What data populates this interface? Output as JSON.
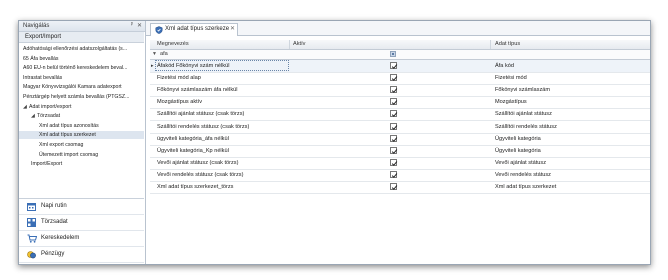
{
  "nav": {
    "title": "Navigálás",
    "pin": "ᵖ",
    "close": "✕",
    "section": "Export/Import",
    "tree": [
      {
        "label": "Adóhatósági ellenőrzési adatszolgáltatás (s...",
        "indent": 0,
        "arrow": "",
        "selected": false
      },
      {
        "label": "65 Áfa bevallás",
        "indent": 0,
        "arrow": "",
        "selected": false
      },
      {
        "label": "A60 EU-n belül történő kereskedelem beval...",
        "indent": 0,
        "arrow": "",
        "selected": false
      },
      {
        "label": "Intrastat bevallás",
        "indent": 0,
        "arrow": "",
        "selected": false
      },
      {
        "label": "Magyar Könyvvizsgálói Kamara adatexport",
        "indent": 0,
        "arrow": "",
        "selected": false
      },
      {
        "label": "Pénztárgép helyett számla bevallás (PTGSZ...",
        "indent": 0,
        "arrow": "",
        "selected": false
      },
      {
        "label": "Adat import/export",
        "indent": 0,
        "arrow": "◢",
        "selected": false
      },
      {
        "label": "Törzsadat",
        "indent": 1,
        "arrow": "◢",
        "selected": false
      },
      {
        "label": "Xml adat típus azonosítás",
        "indent": 2,
        "arrow": "",
        "selected": false
      },
      {
        "label": "Xml adat típus szerkezet",
        "indent": 2,
        "arrow": "",
        "selected": true
      },
      {
        "label": "Xml export csomag",
        "indent": 2,
        "arrow": "",
        "selected": false
      },
      {
        "label": "Ütemezett import csomag",
        "indent": 2,
        "arrow": "",
        "selected": false
      },
      {
        "label": "Import/Export",
        "indent": 1,
        "arrow": "",
        "selected": false
      }
    ],
    "modules": [
      {
        "label": "Napi rutin",
        "icon": "calendar-icon"
      },
      {
        "label": "Törzsadat",
        "icon": "grid-icon"
      },
      {
        "label": "Kereskedelem",
        "icon": "cart-icon"
      },
      {
        "label": "Pénzügy",
        "icon": "coins-icon"
      }
    ]
  },
  "tab": {
    "label": "Xml adat típus szerkeze",
    "close": "✕"
  },
  "grid": {
    "headers": [
      "Megnevezés",
      "Aktív",
      "Adat típus"
    ],
    "filter_indicator": "▼",
    "filter_value": "afa",
    "row_indicator": "▸",
    "rows": [
      {
        "name": "Áfakód Főkönyvi szám nélkül",
        "active": true,
        "type": "Áfa kód"
      },
      {
        "name": "Fizetési mód alap",
        "active": true,
        "type": "Fizetési mód"
      },
      {
        "name": "Főkönyvi számlaszám áfa nélkül",
        "active": true,
        "type": "Főkönyvi számlaszám"
      },
      {
        "name": "Mozgástípus aktív",
        "active": true,
        "type": "Mozgástípus"
      },
      {
        "name": "Szállítói ajánlat státusz (csak törzs)",
        "active": true,
        "type": "Szállítói ajánlat státusz"
      },
      {
        "name": "Szállítói rendelés státusz (csak törzs)",
        "active": true,
        "type": "Szállítói rendelés státusz"
      },
      {
        "name": "ügyviteli kategória_áfa nélkül",
        "active": true,
        "type": "Ügyviteli kategória"
      },
      {
        "name": "Ügyviteli kategória_Kp nélkül",
        "active": true,
        "type": "Ügyviteli kategória"
      },
      {
        "name": "Vevői ajánlat státusz (csak törzs)",
        "active": true,
        "type": "Vevői ajánlat státusz"
      },
      {
        "name": "Vevői rendelés státusz (csak törzs)",
        "active": true,
        "type": "Vevői rendelés státusz"
      },
      {
        "name": "Xml adat típus szerkezet_törzs",
        "active": true,
        "type": "Xml adat típus szerkezet"
      }
    ]
  },
  "colors": {
    "accent": "#3b6fb6",
    "selected_row": "#dde5ef",
    "border": "#b9c3cf"
  }
}
